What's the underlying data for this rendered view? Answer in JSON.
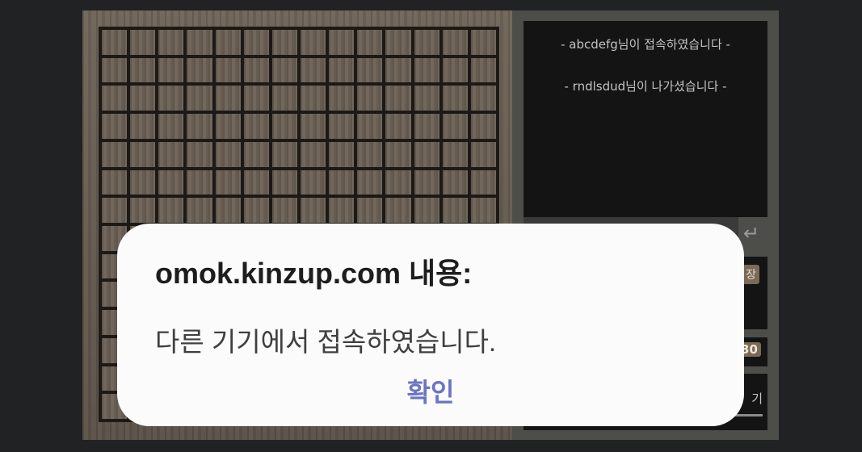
{
  "chat": {
    "messages": [
      "- abcdefg님이 접속하였습니다 -",
      "- rndlsdud님이 나가셨습니다 -"
    ],
    "send_icon": "enter-arrow-icon",
    "input_value": "",
    "input_placeholder": ""
  },
  "side": {
    "badge_partial": "장",
    "number_partial": "30",
    "button_partial": "기"
  },
  "dialog": {
    "title": "omok.kinzup.com 내용:",
    "message": "다른 기기에서 접속하였습니다.",
    "ok_label": "확인",
    "ok_color": "#6b74c4"
  }
}
